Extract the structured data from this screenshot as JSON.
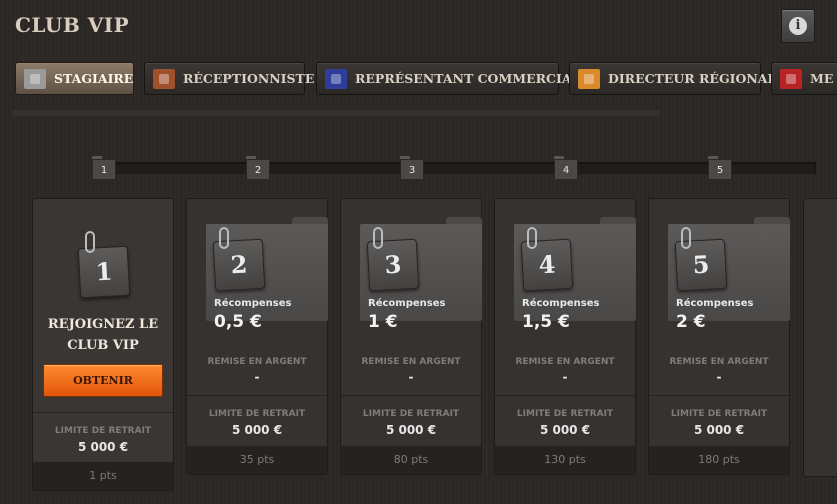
{
  "title": "CLUB VIP",
  "info_icon": "i",
  "tabs": [
    {
      "label": "STAGIAIRE",
      "icon": "thumb-icon",
      "color": "#9a9a9a",
      "active": true
    },
    {
      "label": "RÉCEPTIONNISTE",
      "icon": "cursor-icon",
      "color": "#a0502a",
      "active": false
    },
    {
      "label": "REPRÉSENTANT COMMERCIAL",
      "icon": "phone-icon",
      "color": "#2c3e9a",
      "active": false
    },
    {
      "label": "DIRECTEUR RÉGIONAL",
      "icon": "pen-icon",
      "color": "#d98a2a",
      "active": false
    },
    {
      "label": "ME",
      "icon": "star-icon",
      "color": "#b82424",
      "active": false
    }
  ],
  "levels": [
    "1",
    "2",
    "3",
    "4",
    "5"
  ],
  "first_card": {
    "badge": "1",
    "join_line1": "REJOIGNEZ LE",
    "join_line2": "CLUB VIP",
    "button": "OBTENIR",
    "limit_label": "LIMITE DE RETRAIT",
    "limit_value": "5 000 €",
    "points": "1 pts"
  },
  "cards": [
    {
      "badge": "2",
      "reward_label": "Récompenses",
      "reward_value": "0,5 €",
      "cash_label": "REMISE EN ARGENT",
      "cash_value": "-",
      "limit_label": "LIMITE DE RETRAIT",
      "limit_value": "5 000 €",
      "points": "35 pts"
    },
    {
      "badge": "3",
      "reward_label": "Récompenses",
      "reward_value": "1 €",
      "cash_label": "REMISE EN ARGENT",
      "cash_value": "-",
      "limit_label": "LIMITE DE RETRAIT",
      "limit_value": "5 000 €",
      "points": "80 pts"
    },
    {
      "badge": "4",
      "reward_label": "Récompenses",
      "reward_value": "1,5 €",
      "cash_label": "REMISE EN ARGENT",
      "cash_value": "-",
      "limit_label": "LIMITE DE RETRAIT",
      "limit_value": "5 000 €",
      "points": "130 pts"
    },
    {
      "badge": "5",
      "reward_label": "Récompenses",
      "reward_value": "2 €",
      "cash_label": "REMISE EN ARGENT",
      "cash_value": "-",
      "limit_label": "LIMITE DE RETRAIT",
      "limit_value": "5 000 €",
      "points": "180 pts"
    }
  ],
  "accent_color": "#f26b1d"
}
